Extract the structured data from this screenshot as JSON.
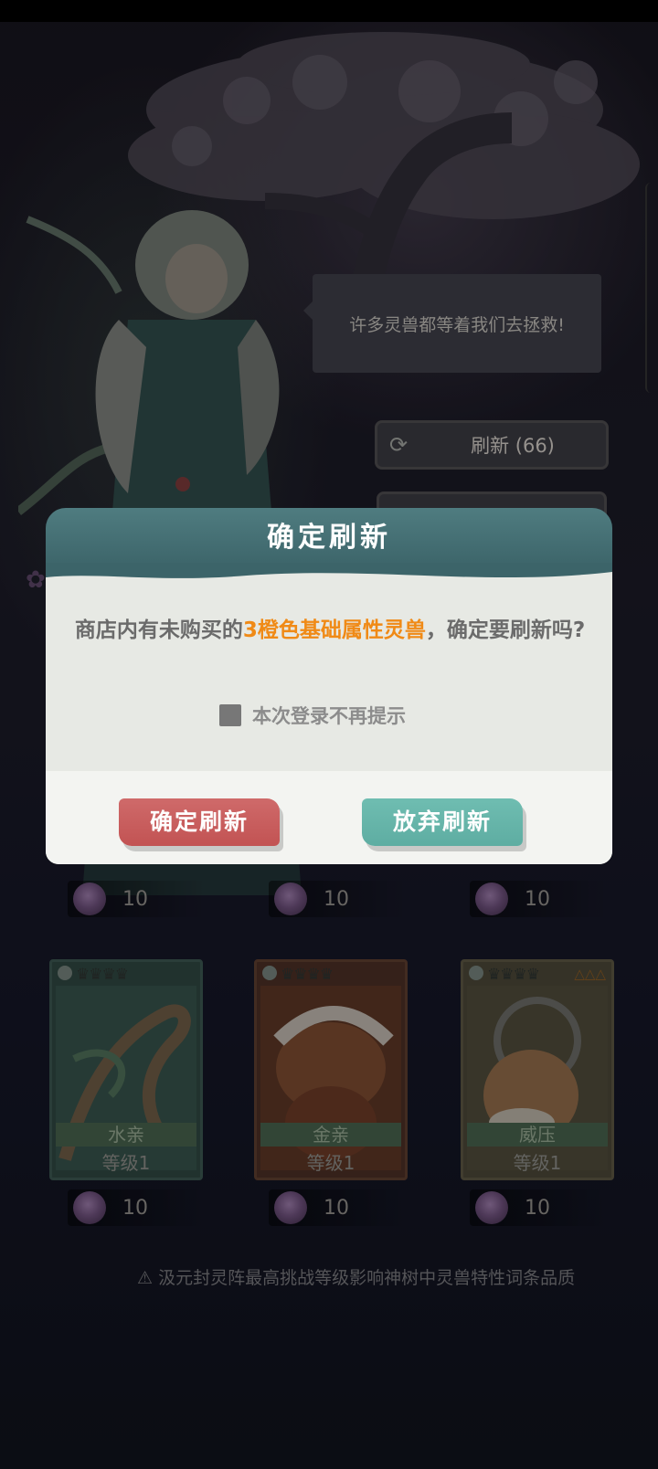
{
  "npc": {
    "speech": "许多灵兽都等着我们去拯救!"
  },
  "toolbar": {
    "refresh_label": "刷新 (66)",
    "refresh_icon": "refresh-icon"
  },
  "shop": {
    "price_rows": [
      [
        "10",
        "10",
        "10"
      ],
      [
        "10",
        "10",
        "10"
      ]
    ],
    "cards": [
      {
        "name": "水亲",
        "level": "等级1"
      },
      {
        "name": "金亲",
        "level": "等级1"
      },
      {
        "name": "威压",
        "level": "等级1"
      }
    ],
    "notice": "⚠ 汲元封灵阵最高挑战等级影响神树中灵兽特性词条品质"
  },
  "dialog": {
    "title": "确定刷新",
    "message_prefix": "商店内有未购买的",
    "message_highlight": "3橙色基础属性灵兽",
    "message_suffix": "，确定要刷新吗?",
    "checkbox_label": "本次登录不再提示",
    "confirm_label": "确定刷新",
    "cancel_label": "放弃刷新",
    "highlight_color": "#f08a16"
  }
}
